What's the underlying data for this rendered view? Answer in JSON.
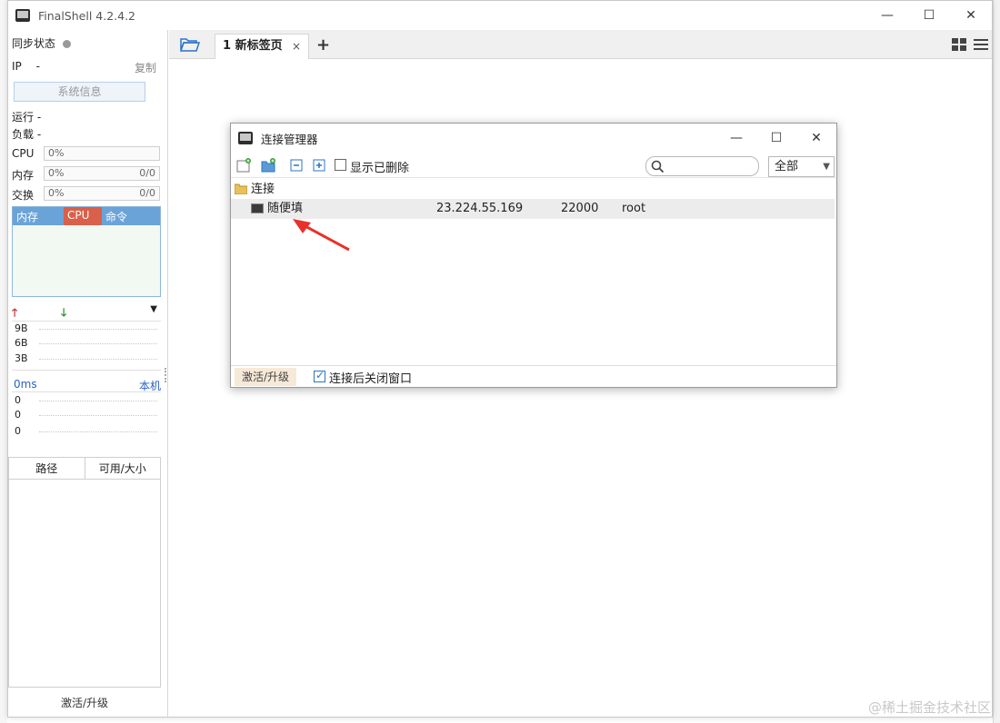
{
  "window": {
    "title": "FinalShell 4.2.4.2",
    "minimize": "—",
    "maximize": "☐",
    "close": "✕"
  },
  "left_panel": {
    "sync_label": "同步状态",
    "ip_label": "IP",
    "ip_value": "-",
    "copy": "复制",
    "sysinfo_button": "系统信息",
    "run_label": "运行 -",
    "load_label": "负载 -",
    "cpu_label": "CPU",
    "cpu_value": "0%",
    "mem_label": "内存",
    "mem_value": "0%",
    "mem_ratio": "0/0",
    "swap_label": "交换",
    "swap_value": "0%",
    "swap_ratio": "0/0",
    "tabs": [
      "内存",
      "CPU",
      "命令"
    ],
    "net_up": "🡑",
    "net_down": "🡓",
    "net_caret": "▼",
    "net_scale": [
      "9B",
      "6B",
      "3B"
    ],
    "ping_label": "0ms",
    "ping_host": "本机",
    "ping_scale": [
      "0",
      "0",
      "0"
    ],
    "disk_cols": [
      "路径",
      "可用/大小"
    ],
    "activate": "激活/升级"
  },
  "tabbar": {
    "tab_label": "1 新标签页",
    "tab_close": "×",
    "add_tab": "+"
  },
  "dialog": {
    "title": "连接管理器",
    "minimize": "—",
    "maximize": "☐",
    "close": "✕",
    "show_deleted": "显示已删除",
    "search_placeholder": "",
    "filter_value": "全部",
    "folder_name": "连接",
    "connection": {
      "name": "随便填",
      "host": "23.224.55.169",
      "port": "22000",
      "user": "root"
    },
    "activate": "激活/升级",
    "close_after_connect": "连接后关闭窗口",
    "close_after_connect_checked": true,
    "show_deleted_checked": false
  },
  "colors": {
    "tab_header_blue": "#6aa3d8",
    "tab_cpu_red": "#d9604a",
    "arrow_red": "#e8312a",
    "folder_blue": "#2b74c6"
  },
  "watermark": "@稀土掘金技术社区"
}
